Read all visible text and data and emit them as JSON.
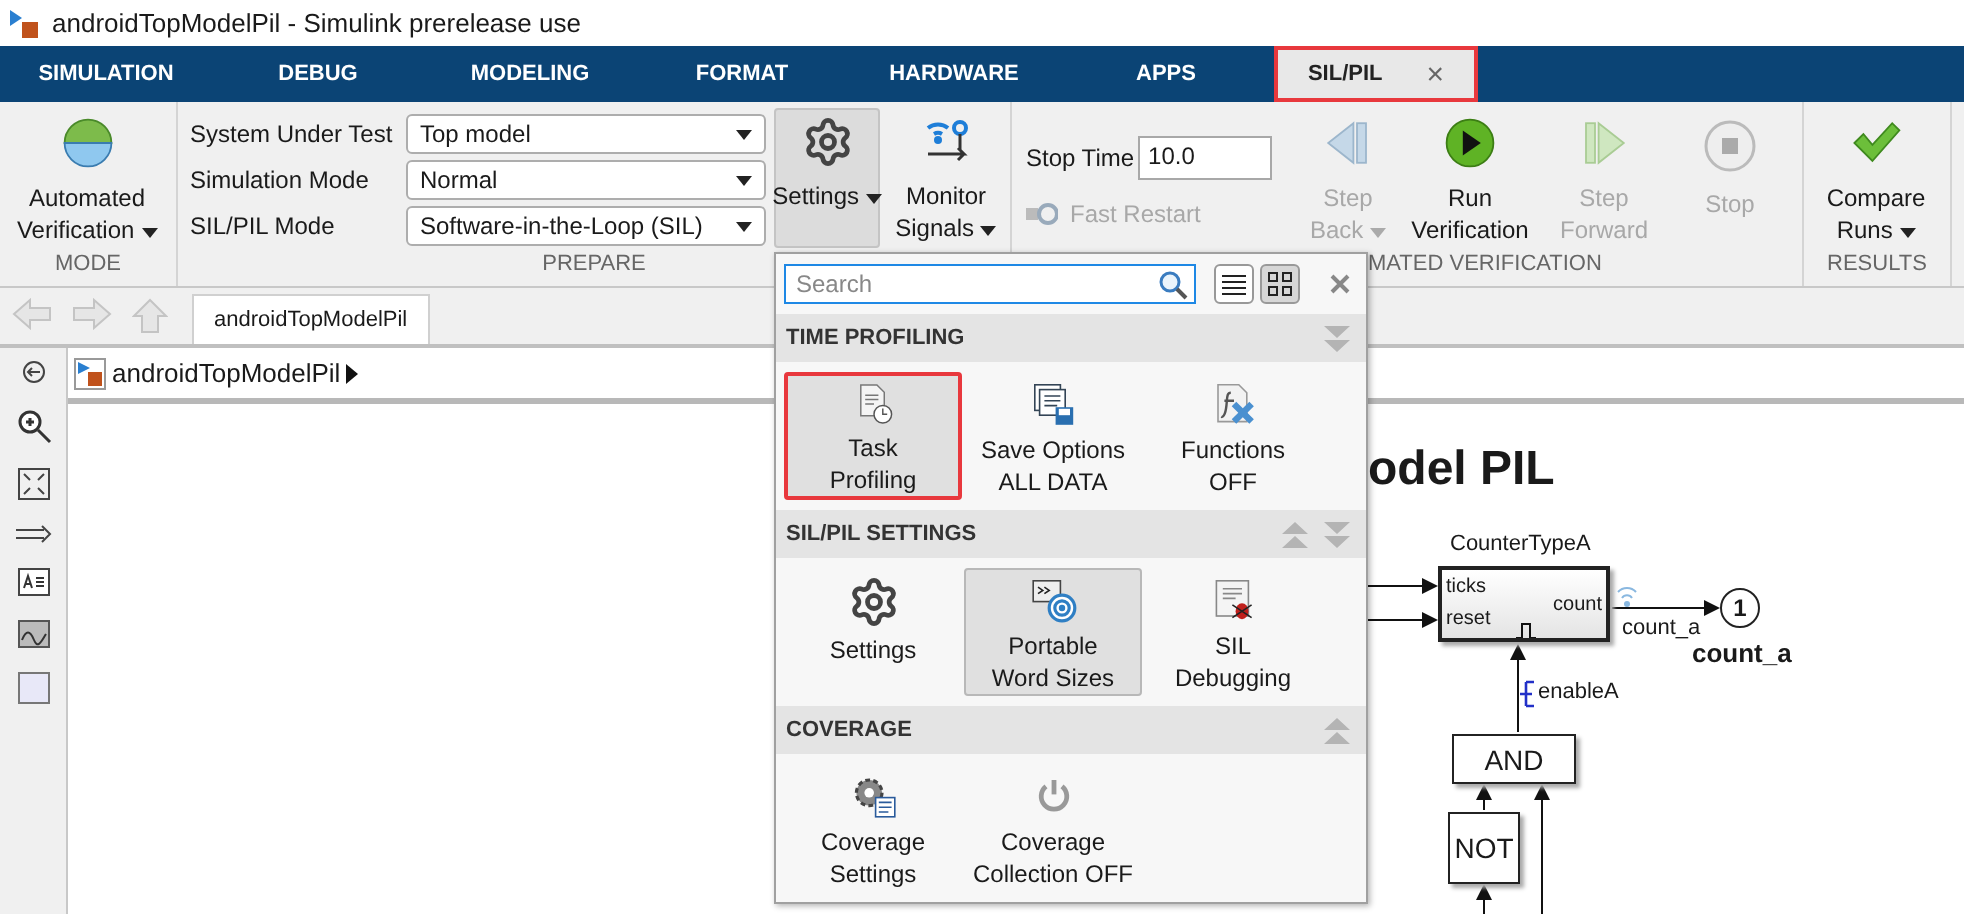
{
  "window": {
    "title": "androidTopModelPil - Simulink prerelease use"
  },
  "tabs": [
    {
      "label": "SIMULATION",
      "selected": false
    },
    {
      "label": "DEBUG",
      "selected": false
    },
    {
      "label": "MODELING",
      "selected": false
    },
    {
      "label": "FORMAT",
      "selected": false
    },
    {
      "label": "HARDWARE",
      "selected": false
    },
    {
      "label": "APPS",
      "selected": false
    },
    {
      "label": "SIL/PIL",
      "selected": true,
      "highlighted": true,
      "close": "×"
    }
  ],
  "mode_section": {
    "title": "MODE",
    "button": {
      "lines": [
        "Automated",
        "Verification"
      ],
      "menu": true
    }
  },
  "prepare_section": {
    "title": "PREPARE",
    "fields": [
      {
        "label": "System Under Test",
        "value": "Top model"
      },
      {
        "label": "Simulation Mode",
        "value": "Normal"
      },
      {
        "label": "SIL/PIL Mode",
        "value": "Software-in-the-Loop (SIL)"
      }
    ],
    "buttons": [
      {
        "kind": "settings",
        "lines": [
          "Settings"
        ],
        "pressed": true,
        "menu": true
      },
      {
        "kind": "monitor",
        "lines": [
          "Monitor",
          "Signals"
        ],
        "pressed": false,
        "menu": true
      }
    ]
  },
  "verification_section": {
    "title": "MATED VERIFICATION",
    "stop_time": {
      "label": "Stop Time",
      "value": "10.0"
    },
    "fast_restart": {
      "label": "Fast Restart",
      "disabled": true
    },
    "buttons": [
      {
        "kind": "step-back",
        "lines": [
          "Step",
          "Back"
        ],
        "disabled": true,
        "menu": true
      },
      {
        "kind": "run",
        "lines": [
          "Run",
          "Verification"
        ],
        "disabled": false,
        "menu": false
      },
      {
        "kind": "step-forward",
        "lines": [
          "Step",
          "Forward"
        ],
        "disabled": true,
        "menu": false
      },
      {
        "kind": "stop",
        "lines": [
          "Stop"
        ],
        "disabled": true,
        "menu": false
      }
    ]
  },
  "results_section": {
    "title": "RESULTS",
    "button": {
      "lines": [
        "Compare",
        "Runs"
      ],
      "menu": true
    }
  },
  "navigation": {
    "tab": "androidTopModelPil"
  },
  "breadcrumb": {
    "path": "androidTopModelPil"
  },
  "popup": {
    "search": {
      "placeholder": "Search"
    },
    "view_modes": [
      {
        "kind": "list",
        "selected": false
      },
      {
        "kind": "grid",
        "selected": true
      }
    ],
    "sections": [
      {
        "title": "TIME PROFILING",
        "move_up": false,
        "move_down": true,
        "items": [
          {
            "kind": "task-profiling",
            "lines": [
              "Task",
              "Profiling"
            ],
            "pressed": true,
            "highlighted": true
          },
          {
            "kind": "save-options",
            "lines": [
              "Save Options",
              "ALL DATA"
            ],
            "pressed": false,
            "highlighted": false
          },
          {
            "kind": "functions",
            "lines": [
              "Functions",
              "OFF"
            ],
            "pressed": false,
            "highlighted": false
          }
        ]
      },
      {
        "title": "SIL/PIL SETTINGS",
        "move_up": true,
        "move_down": true,
        "items": [
          {
            "kind": "settings",
            "lines": [
              "Settings"
            ],
            "pressed": false,
            "highlighted": false
          },
          {
            "kind": "word-sizes",
            "lines": [
              "Portable",
              "Word Sizes"
            ],
            "pressed": true,
            "highlighted": false
          },
          {
            "kind": "debugging",
            "lines": [
              "SIL",
              "Debugging"
            ],
            "pressed": false,
            "highlighted": false
          }
        ]
      },
      {
        "title": "COVERAGE",
        "move_up": true,
        "move_down": false,
        "items": [
          {
            "kind": "coverage-settings",
            "lines": [
              "Coverage",
              "Settings"
            ],
            "pressed": false,
            "highlighted": false
          },
          {
            "kind": "coverage-collection",
            "lines": [
              "Coverage",
              "Collection OFF"
            ],
            "pressed": false,
            "highlighted": false
          }
        ]
      }
    ]
  },
  "canvas": {
    "title": "odel PIL",
    "counter_block": {
      "name": "CounterTypeA",
      "inputs": [
        "ticks",
        "reset"
      ],
      "output": "count"
    },
    "signal_label": "count_a",
    "outport": {
      "number": "1",
      "name": "count_a"
    },
    "enable_label": "enableA",
    "logic_blocks": [
      "AND",
      "NOT"
    ]
  }
}
